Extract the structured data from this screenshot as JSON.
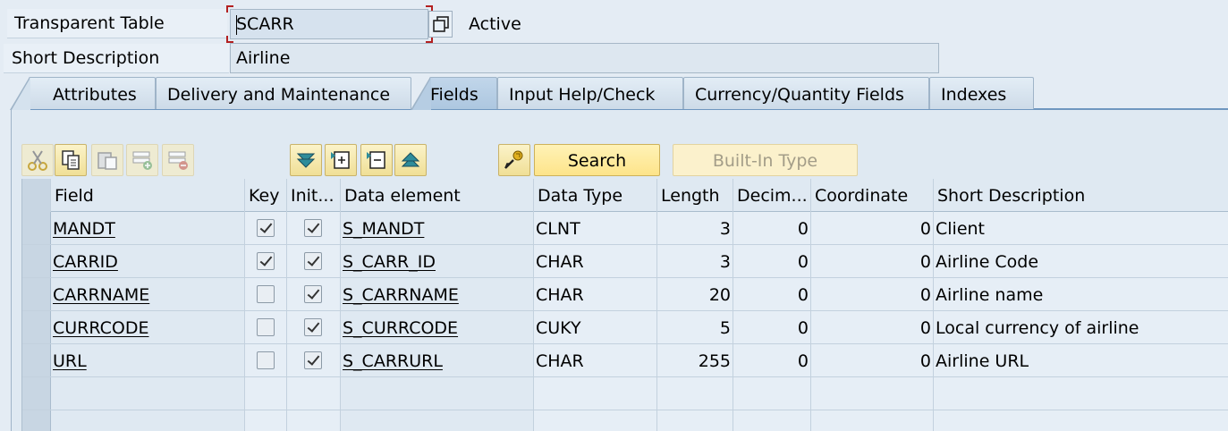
{
  "header": {
    "table_label": "Transparent Table",
    "table_name": "SCARR",
    "status": "Active",
    "desc_label": "Short Description",
    "description": "Airline"
  },
  "tabs": [
    {
      "label": "Attributes",
      "active": false
    },
    {
      "label": "Delivery and Maintenance",
      "active": false
    },
    {
      "label": "Fields",
      "active": true
    },
    {
      "label": "Input Help/Check",
      "active": false
    },
    {
      "label": "Currency/Quantity Fields",
      "active": false
    },
    {
      "label": "Indexes",
      "active": false
    }
  ],
  "toolbar": {
    "icons": [
      "cut-icon",
      "copy-icon",
      "paste-icon",
      "insert-row-icon",
      "delete-row-icon",
      "scroll-down-icon",
      "expand-icon",
      "collapse-icon",
      "scroll-up-icon",
      "key-icon"
    ],
    "search_label": "Search",
    "builtin_label": "Built-In Type"
  },
  "table": {
    "columns": [
      "Field",
      "Key",
      "Init...",
      "Data element",
      "Data Type",
      "Length",
      "Decim...",
      "Coordinate",
      "Short Description"
    ],
    "rows": [
      {
        "field": "MANDT",
        "key": true,
        "init": true,
        "data_element": "S_MANDT",
        "data_type": "CLNT",
        "length": "3",
        "decimals": "0",
        "coordinate": "0",
        "description": "Client"
      },
      {
        "field": "CARRID",
        "key": true,
        "init": true,
        "data_element": "S_CARR_ID",
        "data_type": "CHAR",
        "length": "3",
        "decimals": "0",
        "coordinate": "0",
        "description": "Airline Code"
      },
      {
        "field": "CARRNAME",
        "key": false,
        "init": true,
        "data_element": "S_CARRNAME",
        "data_type": "CHAR",
        "length": "20",
        "decimals": "0",
        "coordinate": "0",
        "description": "Airline name"
      },
      {
        "field": "CURRCODE",
        "key": false,
        "init": true,
        "data_element": "S_CURRCODE",
        "data_type": "CUKY",
        "length": "5",
        "decimals": "0",
        "coordinate": "0",
        "description": "Local currency of airline"
      },
      {
        "field": "URL",
        "key": false,
        "init": true,
        "data_element": "S_CARRURL",
        "data_type": "CHAR",
        "length": "255",
        "decimals": "0",
        "coordinate": "0",
        "description": "Airline URL"
      }
    ]
  },
  "colors": {
    "background": "#e4ecf4",
    "active_tab": "#b6cde3",
    "button_yellow": "#fde48a",
    "focus_red": "#b32020"
  }
}
